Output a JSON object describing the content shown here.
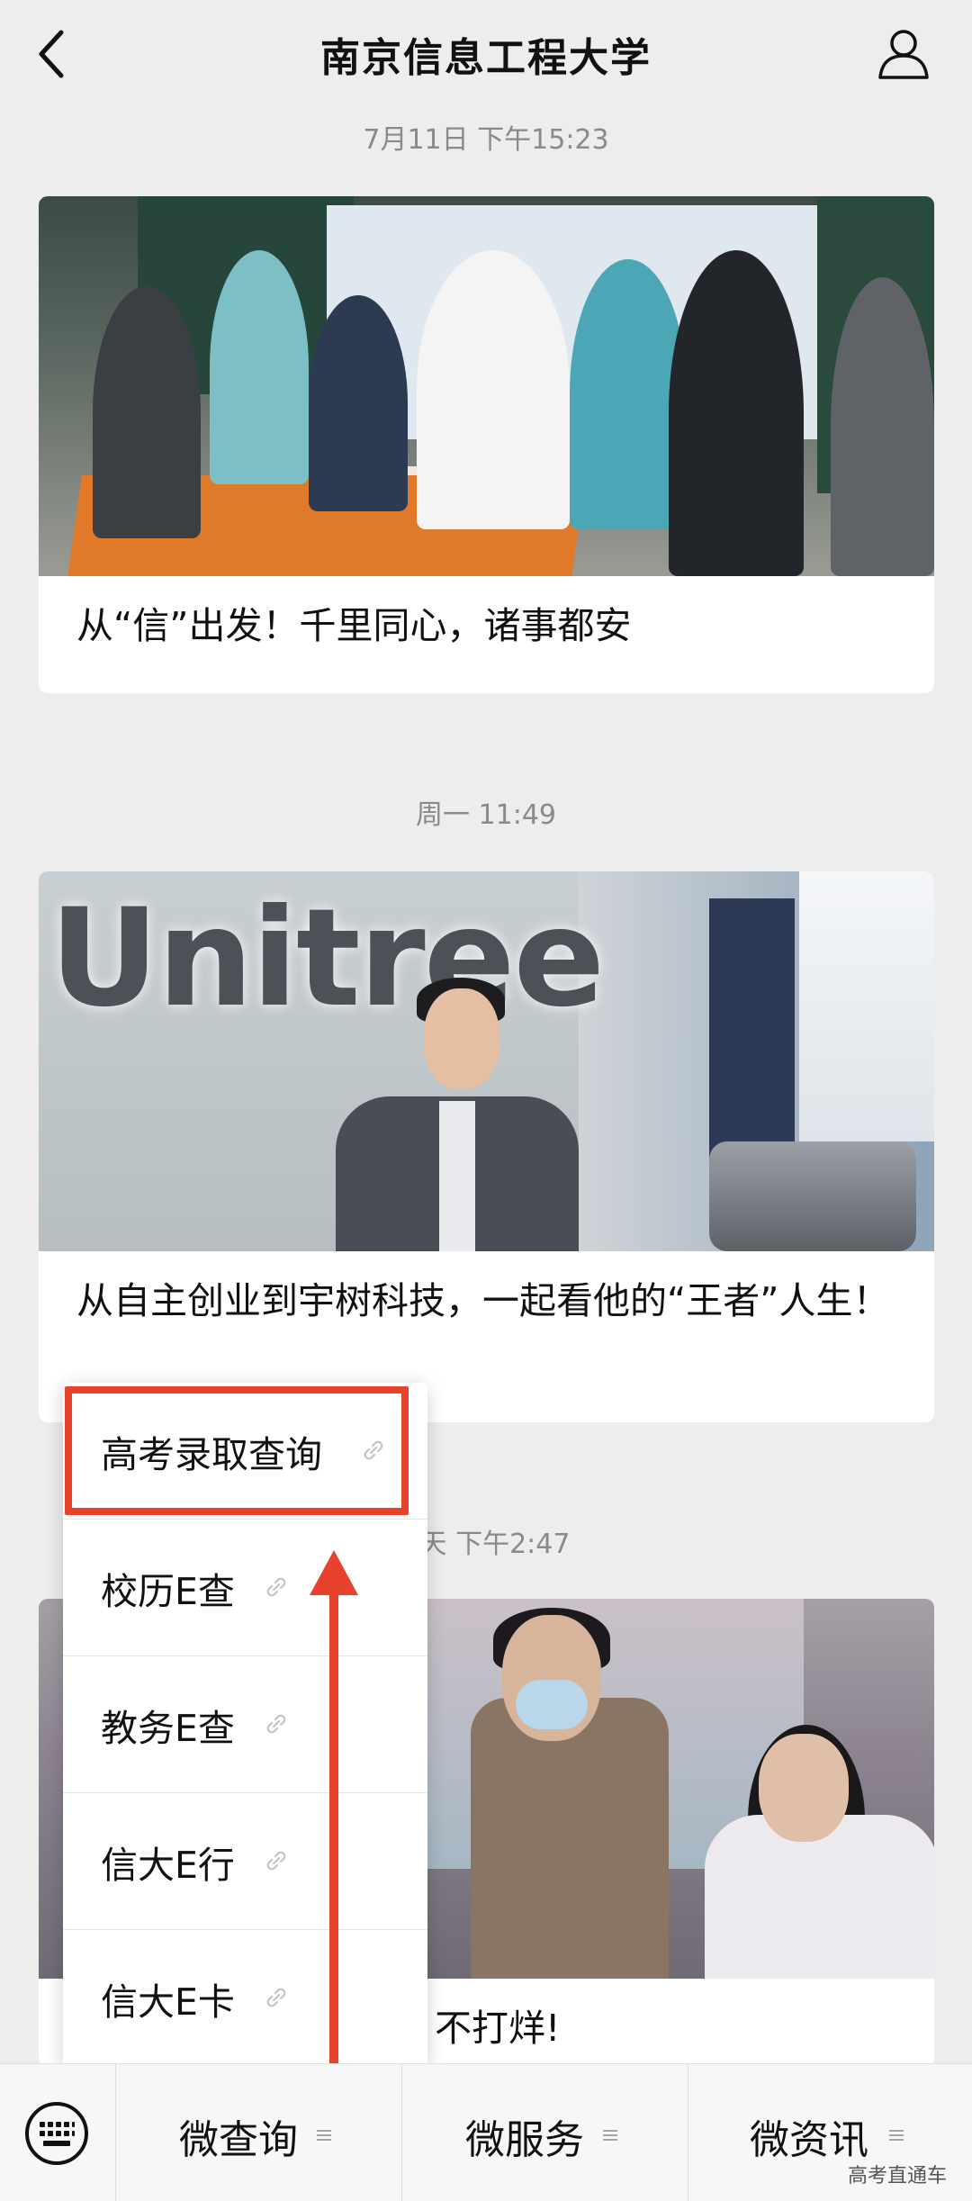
{
  "header": {
    "title": "南京信息工程大学"
  },
  "feed": [
    {
      "timestamp": "7月11日 下午15:23",
      "caption": "从“信”出发！千里同心，诸事都安"
    },
    {
      "timestamp": "周一 11:49",
      "caption": "从自主创业到宇树科技，一起看他的“王者”人生！",
      "photo_text": "Unitree"
    },
    {
      "timestamp": "天 下午2:47",
      "caption": "不打烊!"
    }
  ],
  "menu": {
    "items": [
      {
        "label": "高考录取查询"
      },
      {
        "label": "校历E查"
      },
      {
        "label": "教务E查"
      },
      {
        "label": "信大E行"
      },
      {
        "label": "信大E卡"
      }
    ]
  },
  "bottom_bar": {
    "tabs": [
      {
        "label": "微查询"
      },
      {
        "label": "微服务"
      },
      {
        "label": "微资讯"
      }
    ]
  },
  "watermark": "高考直通车",
  "colors": {
    "background": "#ededed",
    "highlight": "#e8422c",
    "card": "#ffffff"
  }
}
